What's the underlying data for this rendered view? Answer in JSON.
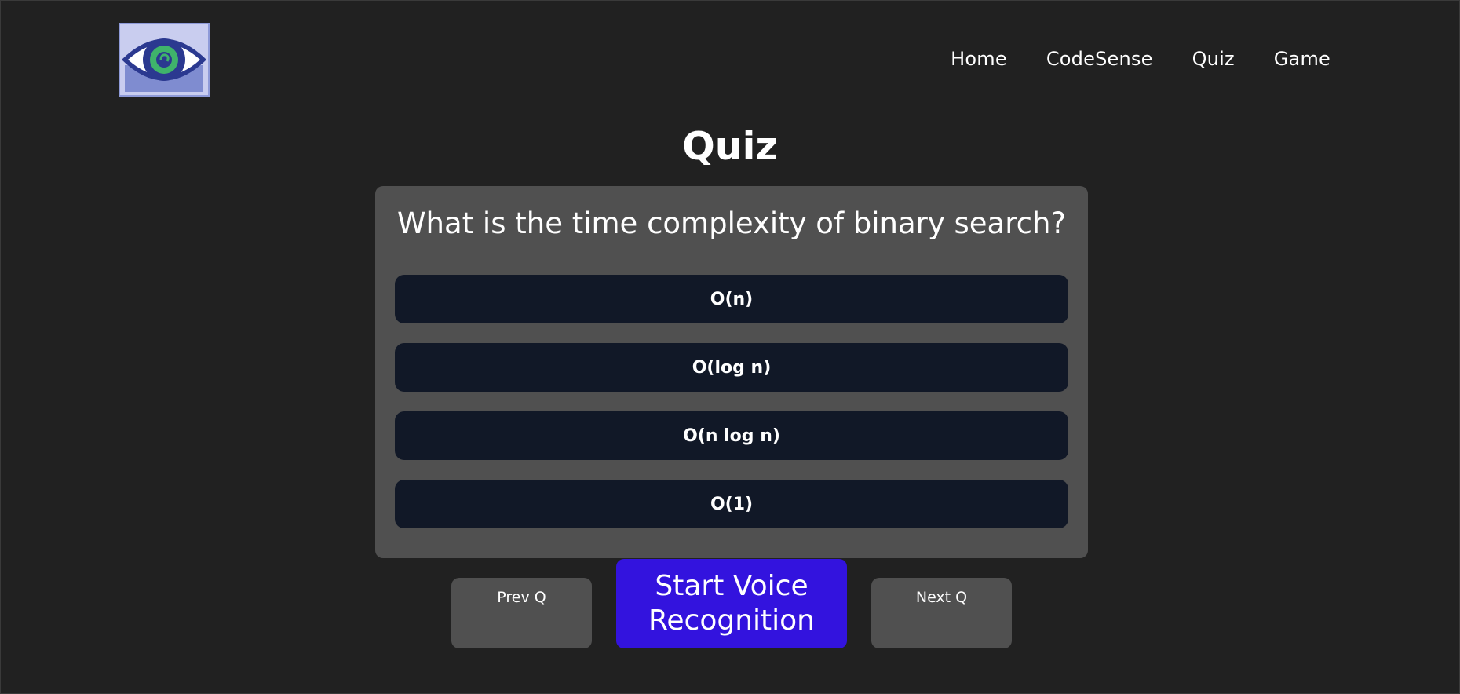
{
  "header": {
    "logo_icon": "eye-logo-icon",
    "nav": [
      {
        "label": "Home"
      },
      {
        "label": "CodeSense"
      },
      {
        "label": "Quiz"
      },
      {
        "label": "Game"
      }
    ]
  },
  "page": {
    "title": "Quiz"
  },
  "quiz": {
    "question": "What is the time complexity of binary search?",
    "options": [
      {
        "label": "O(n)"
      },
      {
        "label": "O(log n)"
      },
      {
        "label": "O(n log n)"
      },
      {
        "label": "O(1)"
      }
    ]
  },
  "controls": {
    "prev_label": "Prev Q",
    "voice_label": "Start Voice Recognition",
    "next_label": "Next Q"
  },
  "colors": {
    "background": "#212121",
    "card": "#505050",
    "option": "#111827",
    "voice_button": "#3313de"
  }
}
